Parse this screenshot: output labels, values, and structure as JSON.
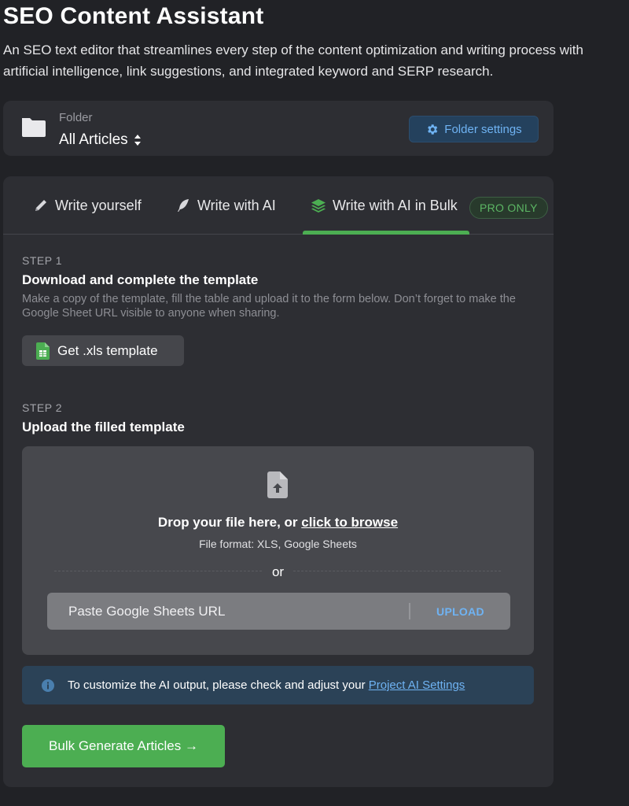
{
  "header": {
    "title": "SEO Content Assistant",
    "description": "An SEO text editor that streamlines every step of the content optimization and writing process with artificial intelligence, link suggestions, and integrated keyword and SERP research."
  },
  "folder": {
    "label": "Folder",
    "value": "All Articles",
    "settings_label": "Folder settings"
  },
  "tabs": [
    {
      "label": "Write yourself",
      "icon": "pencil-icon"
    },
    {
      "label": "Write with AI",
      "icon": "quill-icon"
    },
    {
      "label": "Write with AI in Bulk",
      "icon": "layers-icon",
      "active": true
    }
  ],
  "pro_badge": "PRO ONLY",
  "step1": {
    "label": "STEP 1",
    "title": "Download and complete the template",
    "description": "Make a copy of the template, fill the table and upload it to the form below. Don’t forget to make the Google Sheet URL visible to anyone when sharing.",
    "template_button": "Get .xls template"
  },
  "step2": {
    "label": "STEP 2",
    "title": "Upload the filled template"
  },
  "dropzone": {
    "drop_text": "Drop your file here, or",
    "browse_text": "click to browse",
    "format_text": "File format: XLS, Google Sheets",
    "or_text": "or",
    "url_placeholder": "Paste Google Sheets URL",
    "url_value": "",
    "upload_label": "UPLOAD"
  },
  "info": {
    "text": "To customize the AI output, please check and adjust your",
    "link": "Project AI Settings"
  },
  "generate_button": "Bulk Generate Articles →",
  "colors": {
    "background": "#212226",
    "card": "#2d2e33",
    "accent_green": "#4cae52",
    "accent_blue": "#6fb3f3"
  }
}
